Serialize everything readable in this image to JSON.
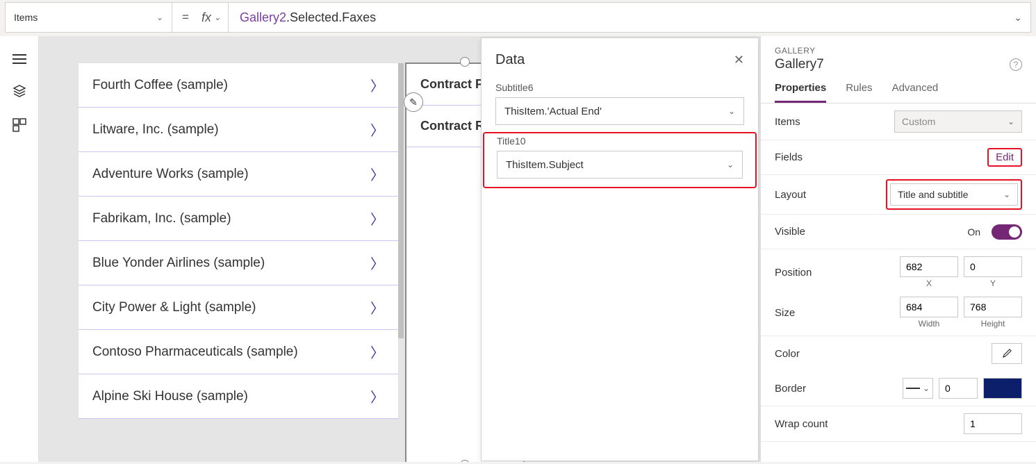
{
  "formula_bar": {
    "property": "Items",
    "fx": "fx",
    "formula_gallery": "Gallery2",
    "formula_rest": ".Selected.Faxes"
  },
  "gallery1": {
    "items": [
      {
        "title": "Fourth Coffee (sample)"
      },
      {
        "title": "Litware, Inc. (sample)"
      },
      {
        "title": "Adventure Works (sample)"
      },
      {
        "title": "Fabrikam, Inc. (sample)"
      },
      {
        "title": "Blue Yonder Airlines (sample)"
      },
      {
        "title": "City Power & Light (sample)"
      },
      {
        "title": "Contoso Pharmaceuticals (sample)"
      },
      {
        "title": "Alpine Ski House (sample)"
      }
    ]
  },
  "gallery2": {
    "items": [
      {
        "title": "Contract Pro"
      },
      {
        "title": "Contract Rev"
      }
    ]
  },
  "data_panel": {
    "title": "Data",
    "subtitle6_label": "Subtitle6",
    "subtitle6_value": "ThisItem.'Actual End'",
    "title10_label": "Title10",
    "title10_value": "ThisItem.Subject"
  },
  "props": {
    "type": "GALLERY",
    "name": "Gallery7",
    "tabs": {
      "properties": "Properties",
      "rules": "Rules",
      "advanced": "Advanced"
    },
    "items_label": "Items",
    "items_value": "Custom",
    "fields_label": "Fields",
    "fields_edit": "Edit",
    "layout_label": "Layout",
    "layout_value": "Title and subtitle",
    "visible_label": "Visible",
    "visible_value": "On",
    "position_label": "Position",
    "position_x": "682",
    "position_y": "0",
    "x_label": "X",
    "y_label": "Y",
    "size_label": "Size",
    "size_w": "684",
    "size_h": "768",
    "w_label": "Width",
    "h_label": "Height",
    "color_label": "Color",
    "border_label": "Border",
    "border_value": "0",
    "wrap_label": "Wrap count",
    "wrap_value": "1"
  }
}
